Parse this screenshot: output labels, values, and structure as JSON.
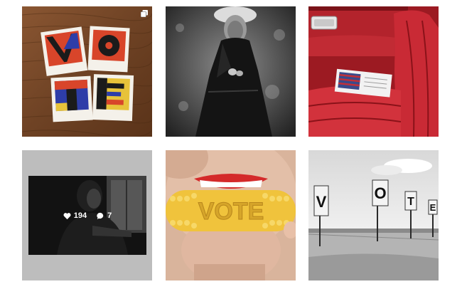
{
  "grid": {
    "posts": [
      {
        "id": "vote-polaroids",
        "letters": [
          "V",
          "O",
          "T",
          "E"
        ],
        "multi": true
      },
      {
        "id": "bw-portrait"
      },
      {
        "id": "red-car-seat"
      },
      {
        "id": "window-portrait",
        "likes": "194",
        "comments": "7"
      },
      {
        "id": "vote-corn",
        "carved_text": "VOTE"
      },
      {
        "id": "vote-signs",
        "signs": [
          "V",
          "O",
          "T",
          "E"
        ]
      }
    ]
  },
  "icons": {
    "multi": "multiple-images-icon",
    "like": "heart-icon",
    "comment": "speech-bubble-icon"
  },
  "colors": {
    "background": "#ffffff",
    "overlay_frame": "#bdbdbd"
  }
}
